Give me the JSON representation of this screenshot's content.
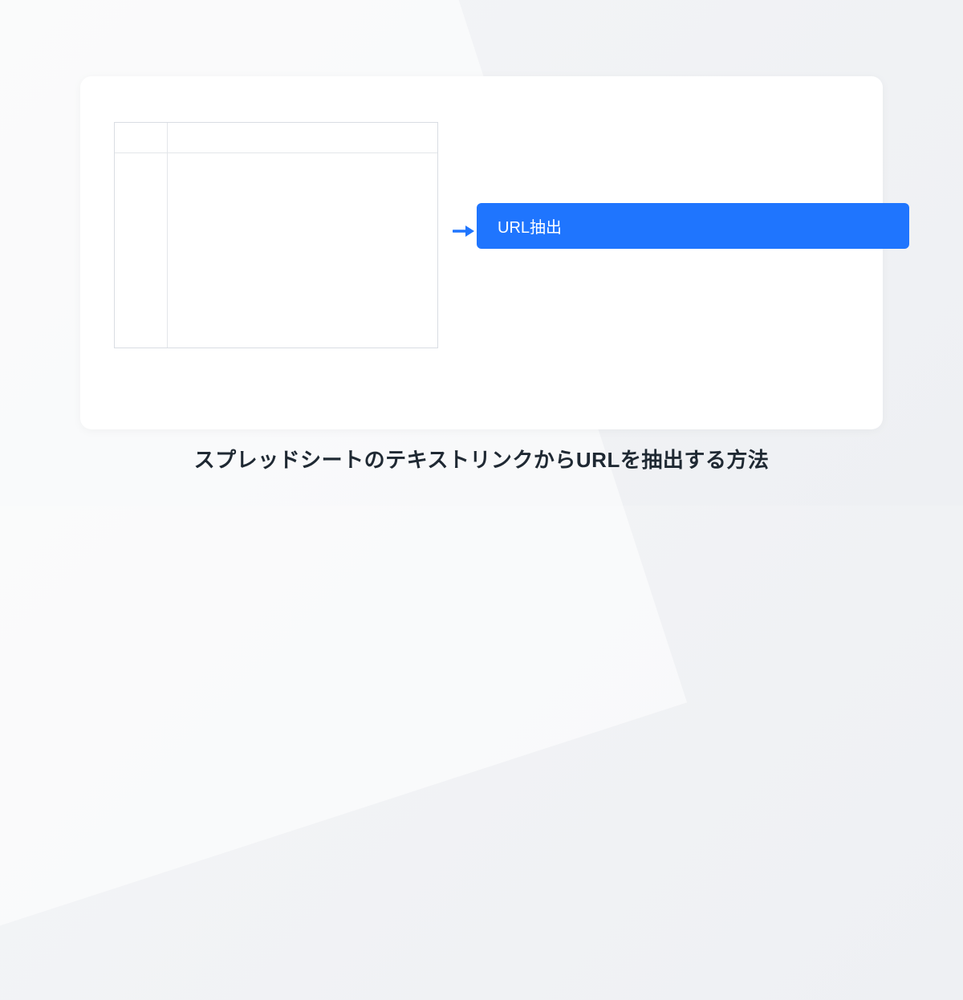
{
  "menu": {
    "extract_url_label": "URL抽出"
  },
  "caption": {
    "text": "スプレッドシートのテキストリンクからURLを抽出する方法"
  },
  "colors": {
    "accent": "#1f75fe",
    "border": "#d9dde3",
    "text": "#1f2933"
  }
}
